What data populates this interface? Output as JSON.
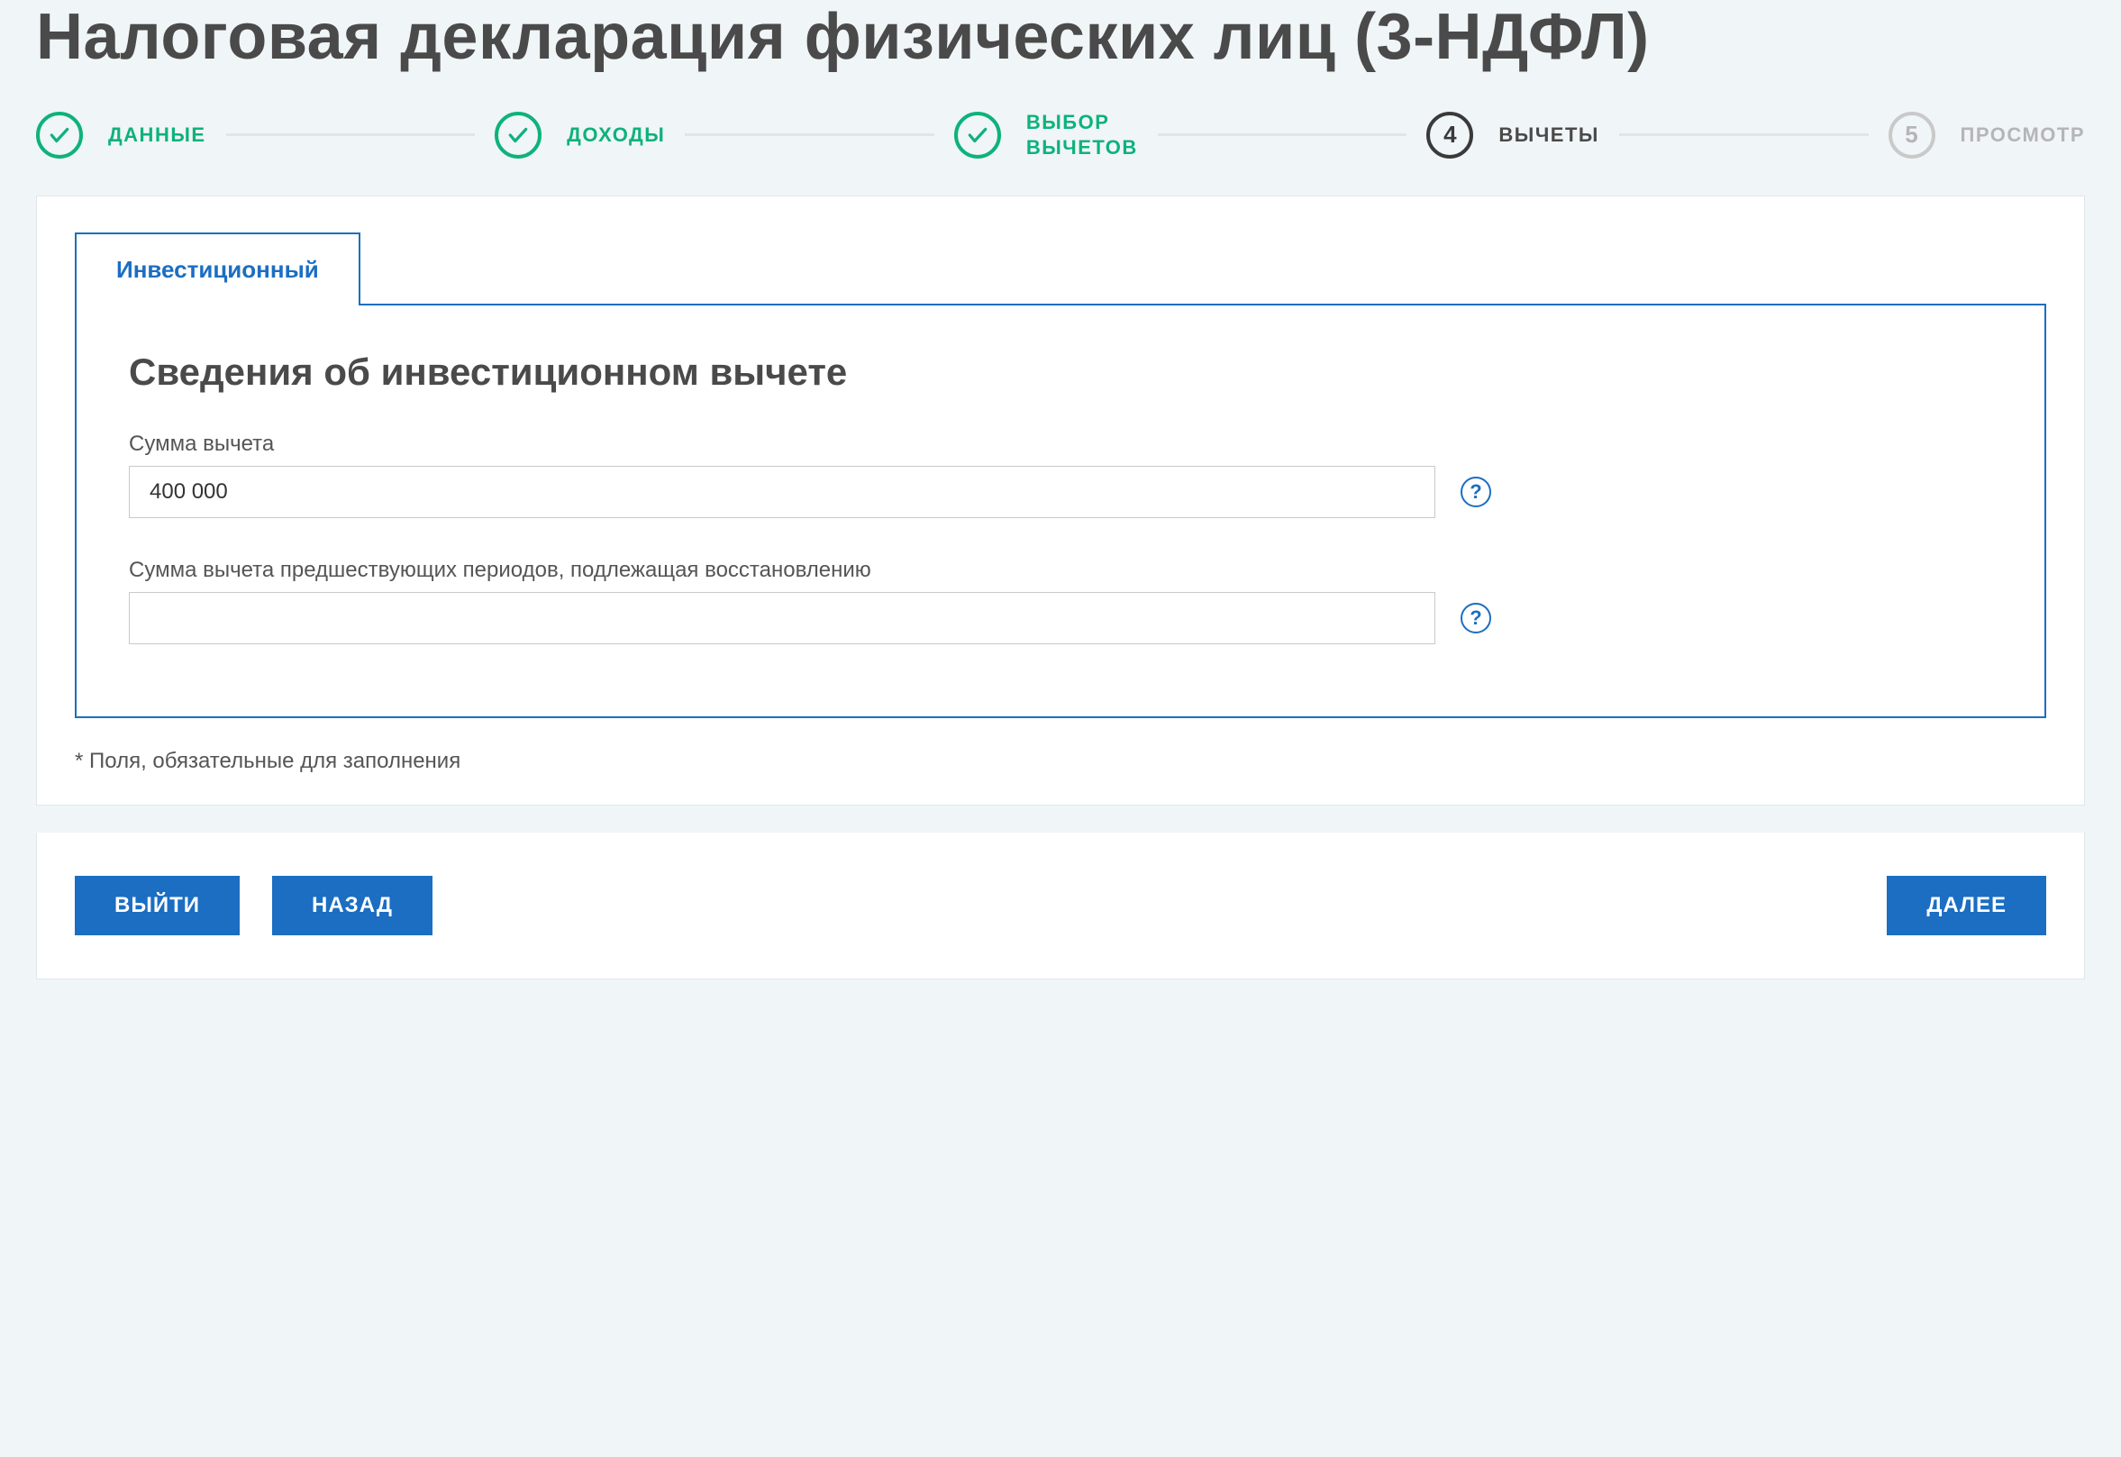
{
  "page_title": "Налоговая декларация физических лиц (3-НДФЛ)",
  "steps": [
    {
      "label": "ДАННЫЕ",
      "status": "done"
    },
    {
      "label": "ДОХОДЫ",
      "status": "done"
    },
    {
      "label": "ВЫБОР\nВЫЧЕТОВ",
      "status": "done"
    },
    {
      "label": "ВЫЧЕТЫ",
      "status": "current",
      "number": "4"
    },
    {
      "label": "ПРОСМОТР",
      "status": "future",
      "number": "5"
    }
  ],
  "tab": {
    "label": "Инвестиционный"
  },
  "panel": {
    "title": "Сведения об инвестиционном вычете",
    "fields": {
      "amount": {
        "label": "Сумма вычета",
        "value": "400 000"
      },
      "prior": {
        "label": "Сумма вычета предшествующих периодов, подлежащая восстановлению",
        "value": ""
      }
    },
    "help_symbol": "?"
  },
  "footnote": "* Поля, обязательные для заполнения",
  "buttons": {
    "exit": "ВЫЙТИ",
    "back": "НАЗАД",
    "next": "ДАЛЕЕ"
  }
}
